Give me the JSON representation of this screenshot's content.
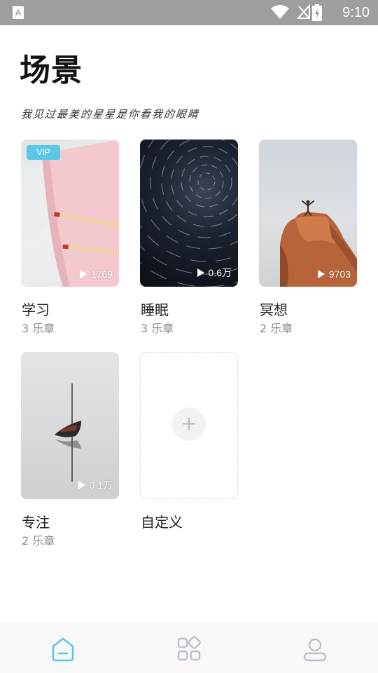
{
  "status_bar": {
    "app_icon_label": "A",
    "time": "9:10"
  },
  "page": {
    "title": "场景",
    "tagline": "我见过最美的星星是你看我的眼睛"
  },
  "scenes": [
    {
      "title": "学习",
      "chapters": "3 乐章",
      "plays": "1769",
      "badge": "VIP"
    },
    {
      "title": "睡眠",
      "chapters": "3 乐章",
      "plays": "0.6万"
    },
    {
      "title": "冥想",
      "chapters": "2 乐章",
      "plays": "9703"
    },
    {
      "title": "专注",
      "chapters": "2 乐章",
      "plays": "0.1万"
    }
  ],
  "custom_card": {
    "title": "自定义",
    "plus": "+"
  },
  "bottom_nav": {
    "items": [
      {
        "icon": "home-icon",
        "active": true
      },
      {
        "icon": "grid-icon",
        "active": false
      },
      {
        "icon": "profile-icon",
        "active": false
      }
    ],
    "active_color": "#5bc8e6",
    "inactive_color": "#b8c2cc"
  },
  "colors": {
    "accent": "#5bc8e6",
    "status_bar": "#9e9e9e"
  }
}
